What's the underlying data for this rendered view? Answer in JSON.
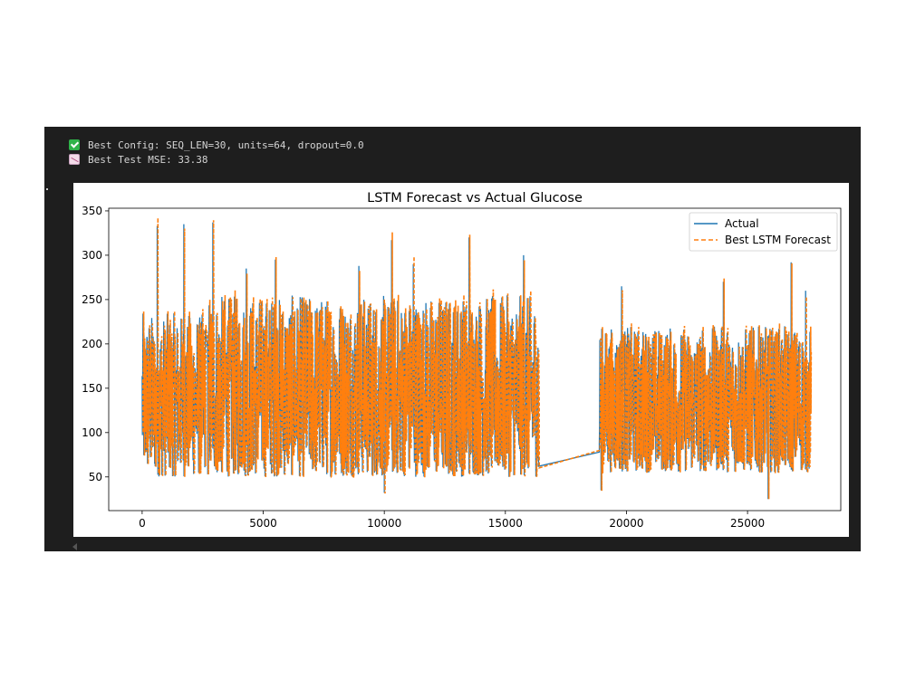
{
  "output": {
    "lines": [
      {
        "icon": "check-mark-icon",
        "text": "Best Config: SEQ_LEN=30, units=64, dropout=0.0"
      },
      {
        "icon": "chart-decreasing-icon",
        "text": "Best Test MSE: 33.38"
      }
    ]
  },
  "chart_data": {
    "type": "line",
    "title": "LSTM Forecast vs Actual Glucose",
    "xlabel": "",
    "ylabel": "",
    "xlim": [
      -1380,
      28850
    ],
    "ylim": [
      12,
      353
    ],
    "xticks": [
      0,
      5000,
      10000,
      15000,
      20000,
      25000
    ],
    "yticks": [
      50,
      100,
      150,
      200,
      250,
      300,
      350
    ],
    "grid": false,
    "legend_position": "top-right",
    "series": [
      {
        "name": "Actual",
        "color": "#1f77b4",
        "style": "solid"
      },
      {
        "name": "Best LSTM Forecast",
        "color": "#ff7f0e",
        "style": "dashed"
      }
    ],
    "x_range": [
      0,
      27600
    ],
    "approx_value_range": [
      25,
      338
    ],
    "segments": [
      {
        "x": [
          0,
          2600
        ],
        "low": 50,
        "high": 235
      },
      {
        "x": [
          2700,
          16370
        ],
        "low": 50,
        "high": 255
      },
      {
        "x": [
          18880,
          27600
        ],
        "low": 55,
        "high": 220
      }
    ],
    "bridge": {
      "x": [
        16370,
        18880
      ],
      "y": [
        62,
        78
      ]
    },
    "spikes": [
      {
        "x": 620,
        "y": 333
      },
      {
        "x": 1720,
        "y": 335
      },
      {
        "x": 2920,
        "y": 337
      },
      {
        "x": 4300,
        "y": 285
      },
      {
        "x": 5500,
        "y": 295
      },
      {
        "x": 8950,
        "y": 288
      },
      {
        "x": 10300,
        "y": 317
      },
      {
        "x": 11200,
        "y": 290
      },
      {
        "x": 13500,
        "y": 320
      },
      {
        "x": 15750,
        "y": 300
      },
      {
        "x": 19800,
        "y": 265
      },
      {
        "x": 24000,
        "y": 270
      },
      {
        "x": 26800,
        "y": 292
      },
      {
        "x": 27400,
        "y": 260
      }
    ],
    "dips": [
      {
        "x": 10000,
        "y": 32
      },
      {
        "x": 25850,
        "y": 25
      },
      {
        "x": 18950,
        "y": 35
      }
    ]
  }
}
